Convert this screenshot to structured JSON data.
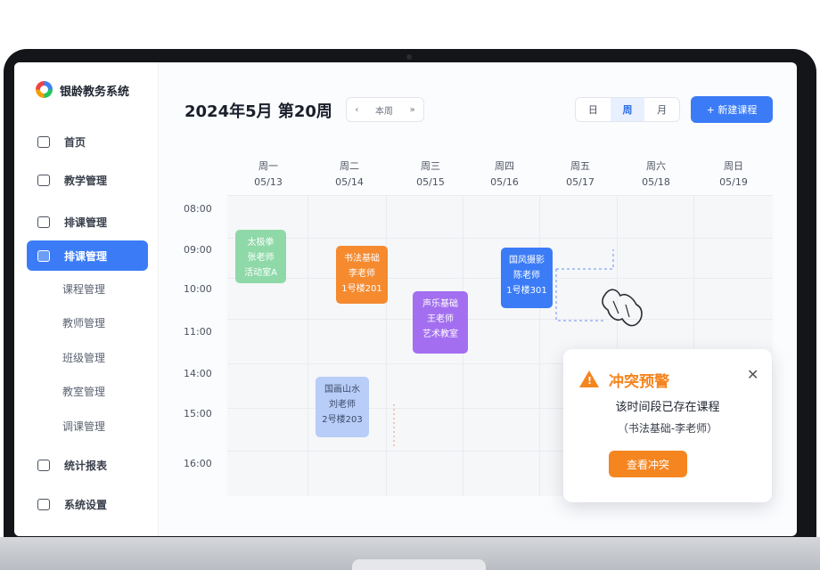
{
  "app": {
    "name": "银龄教务系统"
  },
  "sidebar": {
    "items": [
      {
        "label": "首页",
        "icon": "home-icon"
      },
      {
        "label": "教学管理",
        "icon": "book-icon"
      },
      {
        "label": "排课管理",
        "icon": "calendar-icon"
      },
      {
        "label": "排课管理",
        "icon": "schedule-icon",
        "active": true
      }
    ],
    "sub_items": [
      "课程管理",
      "教师管理",
      "班级管理",
      "教室管理",
      "调课管理"
    ],
    "bottom_items": [
      {
        "label": "统计报表",
        "icon": "chart-icon"
      },
      {
        "label": "系统设置",
        "icon": "settings-icon"
      }
    ]
  },
  "header": {
    "title": "2024年5月  第20周",
    "pager": {
      "prev": "‹",
      "today": "本周",
      "next": "»"
    },
    "views": [
      "日",
      "周",
      "月"
    ],
    "active_view": "周",
    "new_button": "+ 新建课程"
  },
  "calendar": {
    "days": [
      {
        "name": "周一",
        "date": "05/13"
      },
      {
        "name": "周二",
        "date": "05/14"
      },
      {
        "name": "周三",
        "date": "05/15"
      },
      {
        "name": "周四",
        "date": "05/16"
      },
      {
        "name": "周五",
        "date": "05/17"
      },
      {
        "name": "周六",
        "date": "05/18"
      },
      {
        "name": "周日",
        "date": "05/19"
      }
    ],
    "times": [
      "08:00",
      "09:00",
      "10:00",
      "11:00",
      "14:00",
      "15:00",
      "16:00"
    ],
    "events": [
      {
        "title": "太极拳",
        "teacher": "张老师",
        "room": "活动室A"
      },
      {
        "title": "书法基础",
        "teacher": "李老师",
        "room": "1号楼201"
      },
      {
        "title": "声乐基础",
        "teacher": "王老师",
        "room": "艺术教室"
      },
      {
        "title": "国风摄影",
        "teacher": "陈老师",
        "room": "1号楼301"
      },
      {
        "title": "国画山水",
        "teacher": "刘老师",
        "room": "2号楼203"
      }
    ]
  },
  "popup": {
    "title": "冲突预警",
    "message": "该时间段已存在课程",
    "detail": "（书法基础-李老师）",
    "button": "查看冲突"
  },
  "colors": {
    "primary": "#3b7cf6",
    "warning": "#f5851f",
    "green": "#8fd9a8",
    "purple": "#a36ff0"
  }
}
